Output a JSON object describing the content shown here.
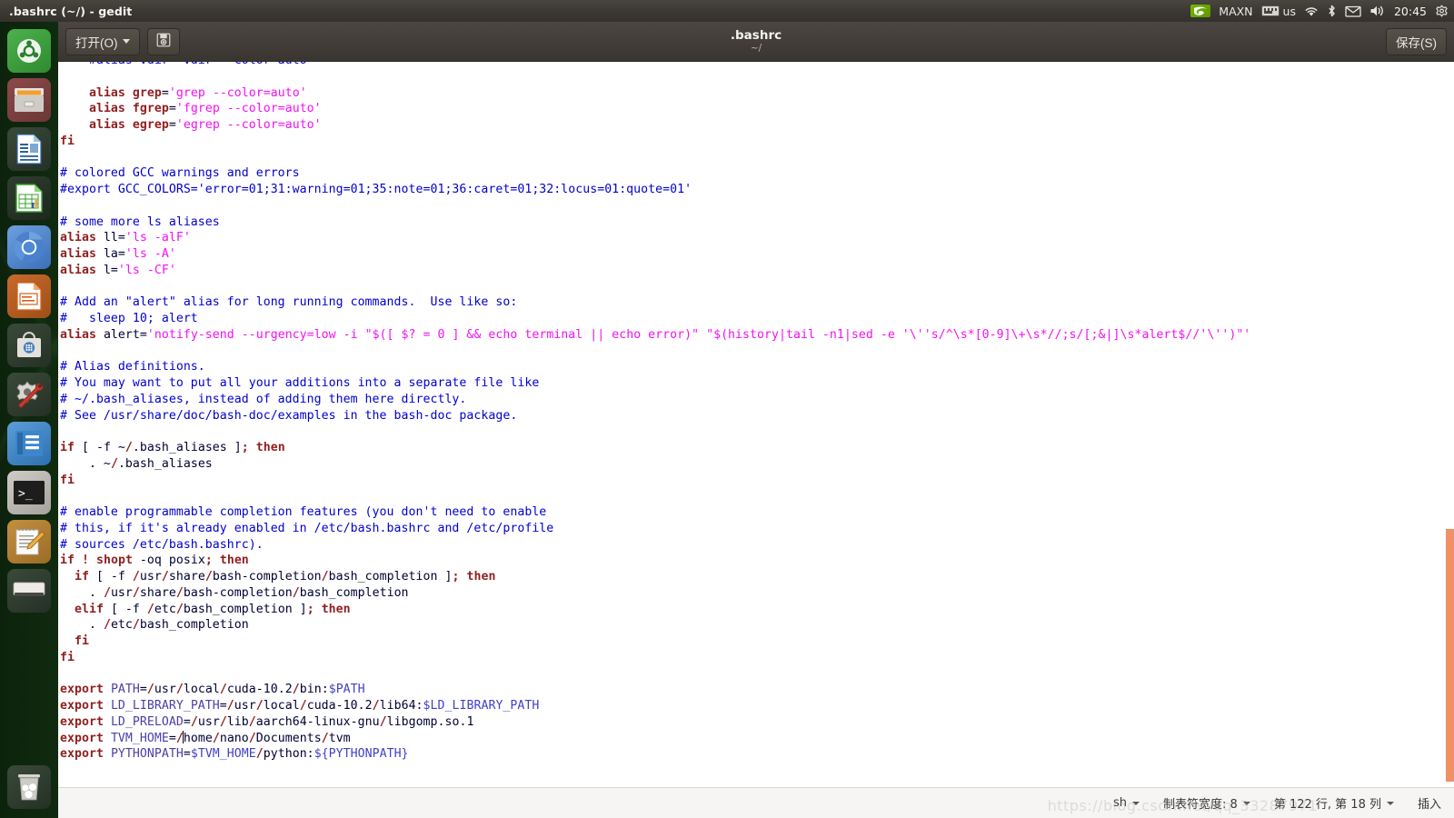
{
  "panel": {
    "title": ".bashrc (~/) - gedit",
    "tray": {
      "nvidia_label": "MAXN",
      "keyboard_layout": "us",
      "wifi_icon": "wifi-icon",
      "bluetooth_icon": "bluetooth-icon",
      "mail_icon": "mail-icon",
      "volume_icon": "volume-icon",
      "clock": "20:45",
      "system_menu_icon": "gear-icon"
    }
  },
  "launcher": {
    "items": [
      {
        "name": "ubuntu-dash",
        "label": "Dash home"
      },
      {
        "name": "files",
        "label": "Files"
      },
      {
        "name": "libreoffice-writer",
        "label": "LibreOffice Writer"
      },
      {
        "name": "libreoffice-calc",
        "label": "LibreOffice Calc"
      },
      {
        "name": "chromium",
        "label": "Chromium Web Browser"
      },
      {
        "name": "libreoffice-impress",
        "label": "LibreOffice Impress"
      },
      {
        "name": "software-center",
        "label": "Ubuntu Software"
      },
      {
        "name": "system-settings",
        "label": "System Settings"
      },
      {
        "name": "help",
        "label": "System Help"
      },
      {
        "name": "terminal",
        "label": "Terminal"
      },
      {
        "name": "gedit",
        "label": "Text Editor"
      },
      {
        "name": "disk-drive",
        "label": "Disk"
      }
    ],
    "trash_label": "Trash"
  },
  "headerbar": {
    "open_label": "打开(O)",
    "save_icon_label": "save-icon",
    "title": ".bashrc",
    "subtitle": "~/",
    "save_label": "保存(S)"
  },
  "statusbar": {
    "language": "sh",
    "tab_width": "制表符宽度: 8",
    "position": "第 122 行, 第 18 列",
    "insert_mode": "插入",
    "watermark": "https://blog.csdn.net/qq_33287971"
  },
  "editor": {
    "colors": {
      "background": "#ffffff",
      "text": "#000033",
      "comment": "#0000d0",
      "keyword": "#8f1f1f",
      "string": "#f510f5",
      "variable": "#4b3fa8",
      "scrollbar": "#ef9164"
    },
    "lines": [
      "    #alias vdir='vdir --color=auto'",
      "",
      "    alias grep='grep --color=auto'",
      "    alias fgrep='fgrep --color=auto'",
      "    alias egrep='egrep --color=auto'",
      "fi",
      "",
      "# colored GCC warnings and errors",
      "#export GCC_COLORS='error=01;31:warning=01;35:note=01;36:caret=01;32:locus=01:quote=01'",
      "",
      "# some more ls aliases",
      "alias ll='ls -alF'",
      "alias la='ls -A'",
      "alias l='ls -CF'",
      "",
      "# Add an \"alert\" alias for long running commands.  Use like so:",
      "#   sleep 10; alert",
      "alias alert='notify-send --urgency=low -i \"$([ $? = 0 ] && echo terminal || echo error)\" \"$(history|tail -n1|sed -e '\\''s/^\\s*[0-9]\\+\\s*//;s/[;&|]\\s*alert$//'\\'')\"'",
      "",
      "# Alias definitions.",
      "# You may want to put all your additions into a separate file like",
      "# ~/.bash_aliases, instead of adding them here directly.",
      "# See /usr/share/doc/bash-doc/examples in the bash-doc package.",
      "",
      "if [ -f ~/.bash_aliases ]; then",
      "    . ~/.bash_aliases",
      "fi",
      "",
      "# enable programmable completion features (you don't need to enable",
      "# this, if it's already enabled in /etc/bash.bashrc and /etc/profile",
      "# sources /etc/bash.bashrc).",
      "if ! shopt -oq posix; then",
      "  if [ -f /usr/share/bash-completion/bash_completion ]; then",
      "    . /usr/share/bash-completion/bash_completion",
      "  elif [ -f /etc/bash_completion ]; then",
      "    . /etc/bash_completion",
      "  fi",
      "fi",
      "",
      "export PATH=/usr/local/cuda-10.2/bin:$PATH",
      "export LD_LIBRARY_PATH=/usr/local/cuda-10.2/lib64:$LD_LIBRARY_PATH",
      "export LD_PRELOAD=/usr/lib/aarch64-linux-gnu/libgomp.so.1",
      "export TVM_HOME=/home/nano/Documents/tvm",
      "export PYTHONPATH=$TVM_HOME/python:${PYTHONPATH}"
    ]
  }
}
